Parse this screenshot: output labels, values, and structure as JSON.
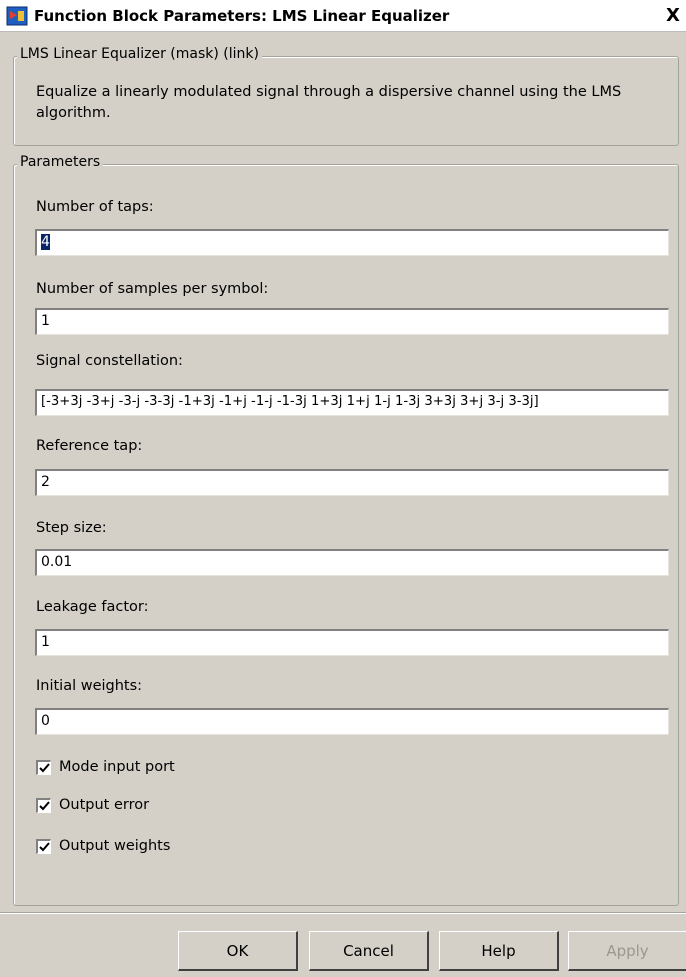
{
  "window": {
    "title": "Function Block Parameters: LMS Linear Equalizer",
    "close_symbol": "X",
    "icon": "simulink-block-icon"
  },
  "mask_group": {
    "legend": "LMS Linear Equalizer (mask) (link)",
    "description_line1": "Equalize a linearly modulated signal through a dispersive channel using the LMS",
    "description_line2": "algorithm."
  },
  "parameters_group": {
    "legend": "Parameters",
    "fields": [
      {
        "label": "Number of taps:",
        "value": "4"
      },
      {
        "label": "Number of samples per symbol:",
        "value": "1"
      },
      {
        "label": "Signal constellation:",
        "value": "[-3+3j -3+j -3-j -3-3j -1+3j -1+j -1-j -1-3j 1+3j 1+j 1-j 1-3j 3+3j 3+j 3-j 3-3j]"
      },
      {
        "label": "Reference tap:",
        "value": "2"
      },
      {
        "label": "Step size:",
        "value": "0.01"
      },
      {
        "label": "Leakage factor:",
        "value": "1"
      },
      {
        "label": "Initial weights:",
        "value": "0"
      }
    ],
    "checkboxes": [
      {
        "label": "Mode input port",
        "checked": true
      },
      {
        "label": "Output error",
        "checked": true
      },
      {
        "label": "Output weights",
        "checked": true
      }
    ]
  },
  "buttons": {
    "ok": "OK",
    "cancel": "Cancel",
    "help": "Help",
    "apply": "Apply"
  },
  "colors": {
    "dialog_bg": "#d4d0c8",
    "selection": "#0a246a",
    "disabled_text": "#9a978f"
  }
}
